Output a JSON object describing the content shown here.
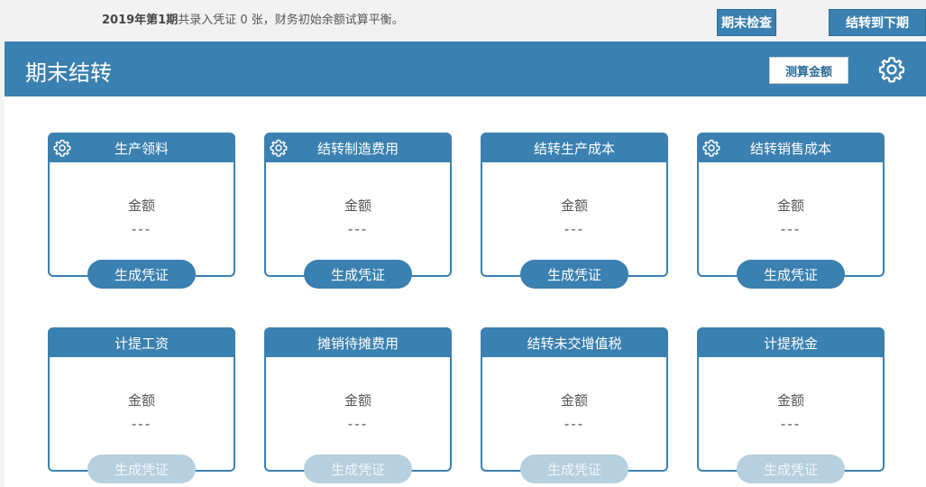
{
  "topbar": {
    "period_bold": "2019年第1期",
    "info_text": "共录入凭证 0 张，财务初始余额试算平衡。",
    "check_button": "期末检查",
    "next_button": "结转到下期"
  },
  "header": {
    "title": "期末结转",
    "calc_button": "测算金额",
    "settings_icon": "gear-icon"
  },
  "cards": [
    {
      "title": "生产领料",
      "amount_label": "金额",
      "amount_value": "---",
      "button": "生成凭证",
      "has_settings": true,
      "button_enabled": true
    },
    {
      "title": "结转制造费用",
      "amount_label": "金额",
      "amount_value": "---",
      "button": "生成凭证",
      "has_settings": true,
      "button_enabled": true
    },
    {
      "title": "结转生产成本",
      "amount_label": "金额",
      "amount_value": "---",
      "button": "生成凭证",
      "has_settings": false,
      "button_enabled": true
    },
    {
      "title": "结转销售成本",
      "amount_label": "金额",
      "amount_value": "---",
      "button": "生成凭证",
      "has_settings": true,
      "button_enabled": true
    },
    {
      "title": "计提工资",
      "amount_label": "金额",
      "amount_value": "---",
      "button": "生成凭证",
      "has_settings": false,
      "button_enabled": false
    },
    {
      "title": "摊销待摊费用",
      "amount_label": "金额",
      "amount_value": "---",
      "button": "生成凭证",
      "has_settings": false,
      "button_enabled": false
    },
    {
      "title": "结转未交增值税",
      "amount_label": "金额",
      "amount_value": "---",
      "button": "生成凭证",
      "has_settings": false,
      "button_enabled": false
    },
    {
      "title": "计提税金",
      "amount_label": "金额",
      "amount_value": "---",
      "button": "生成凭证",
      "has_settings": false,
      "button_enabled": false
    }
  ],
  "colors": {
    "primary": "#3a80b0",
    "disabled_button": "#b7d0df",
    "background": "#f2f2f2"
  }
}
